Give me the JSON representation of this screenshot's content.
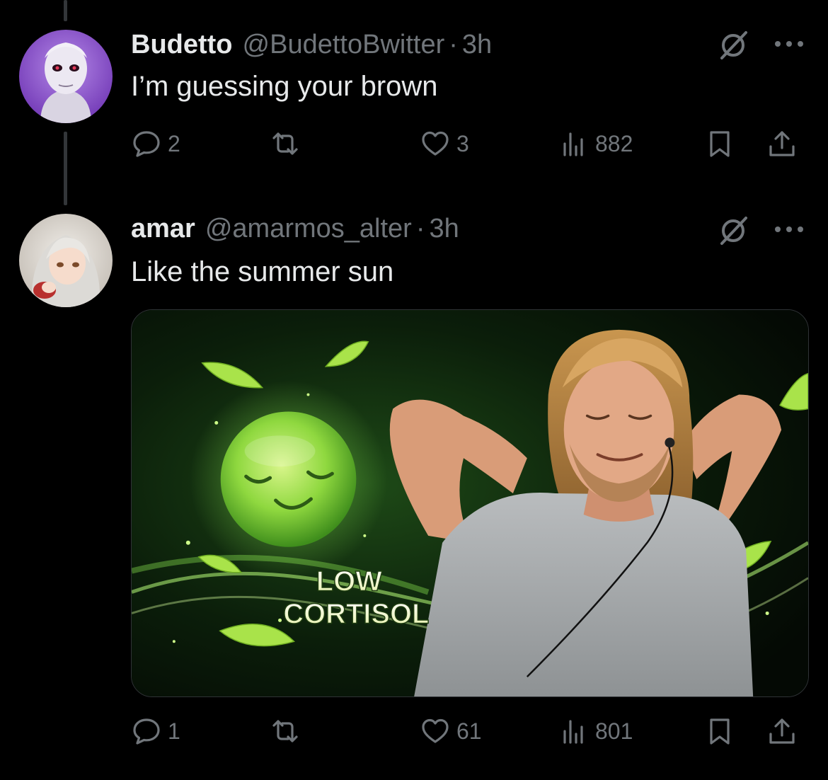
{
  "tweets": [
    {
      "display_name": "Budetto",
      "handle": "@BudettoBwitter",
      "separator": "·",
      "time": "3h",
      "text": "I’m guessing your brown",
      "avatar_icon": "anime-character-avatar",
      "replies": "2",
      "retweets": "",
      "likes": "3",
      "views": "882"
    },
    {
      "display_name": "amar",
      "handle": "@amarmos_alter",
      "separator": "·",
      "time": "3h",
      "text": "Like the summer sun",
      "avatar_icon": "anime-girl-avatar",
      "media": {
        "caption_line1": "LOW",
        "caption_line2": "CORTISOL"
      },
      "replies": "1",
      "retweets": "",
      "likes": "61",
      "views": "801"
    }
  ],
  "colors": {
    "background": "#000000",
    "primary_text": "#e7e9ea",
    "secondary_text": "#71767b",
    "thread_line": "#333639",
    "media_green": "#7dd63a"
  },
  "icons": [
    "reply-icon",
    "retweet-icon",
    "like-icon",
    "views-icon",
    "bookmark-icon",
    "share-icon",
    "grok-icon",
    "more-icon"
  ]
}
